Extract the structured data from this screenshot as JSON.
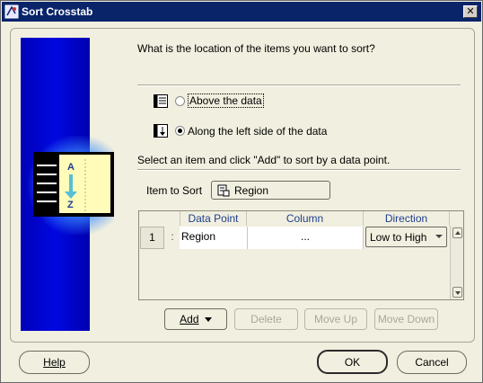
{
  "window": {
    "title": "Sort Crosstab",
    "close_glyph": "✕"
  },
  "question": "What is the location of the items you want to sort?",
  "location_options": [
    {
      "label": "Above the data",
      "selected": false
    },
    {
      "label": "Along the left side of the data",
      "selected": true
    }
  ],
  "instructions": "Select an item and click \"Add\" to sort by a data point.",
  "item_to_sort": {
    "label": "Item to Sort",
    "value": "Region"
  },
  "sort_grid": {
    "columns": [
      "Data Point",
      "Column",
      "Direction"
    ],
    "rows": [
      {
        "number": "1",
        "data_point": "Region",
        "column": "...",
        "direction": "Low to High"
      }
    ]
  },
  "grid_buttons": {
    "add": "Add",
    "delete": "Delete",
    "move_up": "Move Up",
    "move_down": "Move Down"
  },
  "footer_buttons": {
    "help": "Help",
    "ok": "OK",
    "cancel": "Cancel"
  },
  "graphic_letters": {
    "top": "A",
    "bottom": "Z"
  },
  "colors": {
    "title_bar": "#0a246a",
    "side_panel": "#0008e0",
    "dialog_bg": "#f1efdf",
    "header_text": "#1f3f8f"
  }
}
